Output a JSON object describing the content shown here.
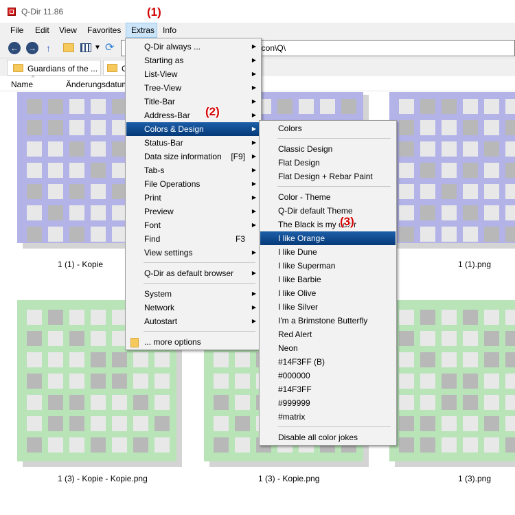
{
  "window": {
    "title": "Q-Dir 11.86"
  },
  "menubar": [
    "File",
    "Edit",
    "View",
    "Favorites",
    "Extras",
    "Info"
  ],
  "address": {
    "value": "g\\icon\\Q\\"
  },
  "tabs": [
    "Guardians of the ...",
    "C"
  ],
  "columns": {
    "name": "Name",
    "date": "Änderungsdatum"
  },
  "thumbs": [
    {
      "caption": "1 (1) - Kopie - Kopie.png",
      "visible_caption": "1 (1) - Kopie",
      "color": "#b3b3e8"
    },
    {
      "caption": "",
      "color": "#b3b3e8"
    },
    {
      "caption": "1 (1).png",
      "color": "#b3b3e8"
    },
    {
      "caption": "1 (3) - Kopie - Kopie.png",
      "color": "#b8e4b8"
    },
    {
      "caption": "1 (3) - Kopie.png",
      "color": "#b8e4b8"
    },
    {
      "caption": "1 (3).png",
      "color": "#b8e4b8"
    }
  ],
  "extras_menu": [
    {
      "label": "Q-Dir always ...",
      "submenu": true
    },
    {
      "label": "Starting as",
      "submenu": true
    },
    {
      "label": "List-View",
      "submenu": true
    },
    {
      "label": "Tree-View",
      "submenu": true
    },
    {
      "label": "Title-Bar",
      "submenu": true
    },
    {
      "label": "Address-Bar",
      "submenu": true
    },
    {
      "label": "Colors & Design",
      "submenu": true,
      "highlight": true
    },
    {
      "label": "Status-Bar",
      "submenu": true
    },
    {
      "label": "Data size information",
      "shortcut": "[F9]",
      "submenu": true
    },
    {
      "label": "Tab-s",
      "submenu": true
    },
    {
      "label": "File Operations",
      "submenu": true
    },
    {
      "label": "Print",
      "submenu": true
    },
    {
      "label": "Preview",
      "submenu": true
    },
    {
      "label": "Font",
      "submenu": true
    },
    {
      "label": "Find",
      "shortcut": "F3"
    },
    {
      "label": "View settings",
      "submenu": true
    },
    {
      "separator": true
    },
    {
      "label": "Q-Dir as default browser",
      "submenu": true
    },
    {
      "separator": true
    },
    {
      "label": "System",
      "submenu": true
    },
    {
      "label": "Network",
      "submenu": true
    },
    {
      "label": "Autostart",
      "submenu": true
    },
    {
      "separator": true
    },
    {
      "label": "... more options",
      "icon": "folder-icon"
    }
  ],
  "colors_menu": [
    {
      "label": "Colors"
    },
    {
      "separator": true
    },
    {
      "label": "Classic Design"
    },
    {
      "label": "Flat Design"
    },
    {
      "label": "Flat Design + Rebar Paint"
    },
    {
      "separator": true
    },
    {
      "label": "Color - Theme"
    },
    {
      "label": "Q-Dir default Theme"
    },
    {
      "label": "The Black is my color"
    },
    {
      "label": "I like Orange",
      "highlight": true
    },
    {
      "label": "I like Dune"
    },
    {
      "label": "I like Superman"
    },
    {
      "label": "I like Barbie"
    },
    {
      "label": "I like Olive"
    },
    {
      "label": "I like Silver"
    },
    {
      "label": "I'm a Brimstone Butterfly"
    },
    {
      "label": "Red Alert"
    },
    {
      "label": "Neon"
    },
    {
      "label": "#14F3FF (B)"
    },
    {
      "label": "#000000"
    },
    {
      "label": "#14F3FF"
    },
    {
      "label": "#999999"
    },
    {
      "label": "#matrix"
    },
    {
      "separator": true
    },
    {
      "label": "Disable all color jokes"
    }
  ],
  "annotations": [
    "(1)",
    "(2)",
    "(3)"
  ],
  "colors": {
    "highlight": "#0a4b91",
    "annotation": "#d40000",
    "folder": "#f5c95c"
  }
}
